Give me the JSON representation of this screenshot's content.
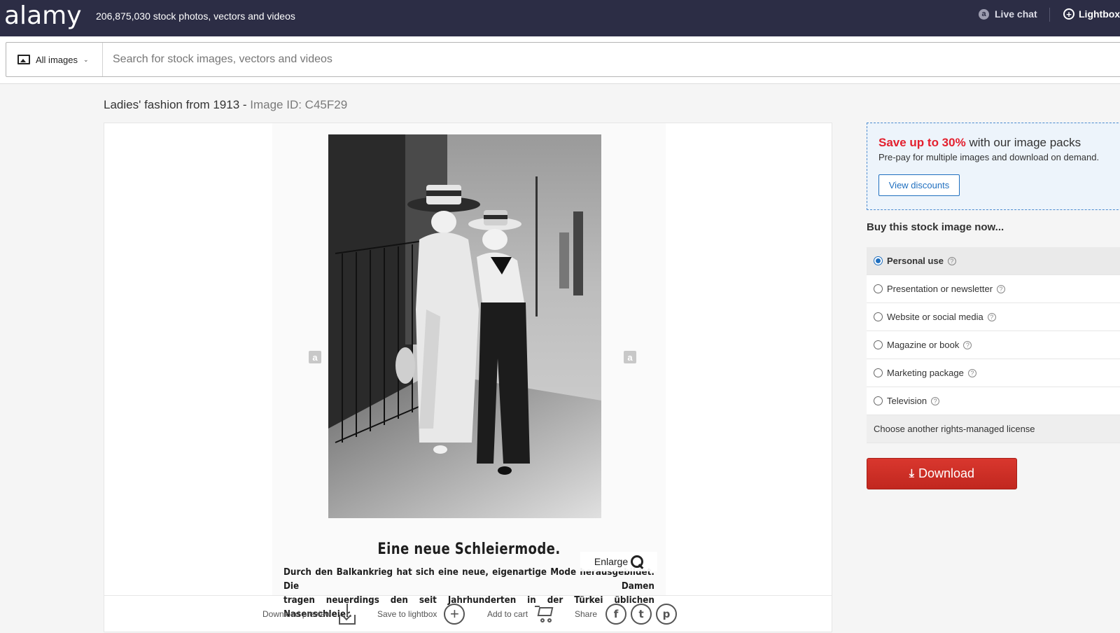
{
  "header": {
    "logo": "alamy",
    "tagline": "206,875,030 stock photos, vectors and videos",
    "live_chat": "Live chat",
    "lightbox": "Lightbox"
  },
  "search": {
    "scope_label": "All images",
    "placeholder": "Search for stock images, vectors and videos",
    "value": ""
  },
  "image": {
    "title": "Ladies' fashion from 1913",
    "id_label": "Image ID: C45F29",
    "caption_title": "Eine neue Schleiermode.",
    "caption_line1": "Durch den Balkankrieg hat sich eine neue, eigenartige Mode herausgebildet. Die Damen",
    "caption_line2": "tragen neuerdings den seit Jahrhunderten in der Türkei üblichen Nasenschleier.",
    "watermark": "a",
    "enlarge": "Enlarge"
  },
  "actions": {
    "download_preview": "Download preview",
    "save_to_lightbox": "Save to lightbox",
    "add_to_cart": "Add to cart",
    "share": "Share",
    "social": [
      "f",
      "t",
      "p"
    ]
  },
  "promo": {
    "highlight": "Save up to 30%",
    "headline_rest": " with our image packs",
    "subtext": "Pre-pay for multiple images and download on demand.",
    "button": "View discounts"
  },
  "buy": {
    "heading": "Buy this stock image now...",
    "licenses": [
      {
        "label": "Personal use",
        "selected": true
      },
      {
        "label": "Presentation or newsletter",
        "selected": false
      },
      {
        "label": "Website or social media",
        "selected": false
      },
      {
        "label": "Magazine or book",
        "selected": false
      },
      {
        "label": "Marketing package",
        "selected": false
      },
      {
        "label": "Television",
        "selected": false
      }
    ],
    "other_license": "Choose another rights-managed license",
    "download_button": "Download"
  },
  "colors": {
    "header_bg": "#2c2d45",
    "accent_blue": "#1f6fbf",
    "promo_red": "#e3202e",
    "download_red": "#c9302c"
  }
}
